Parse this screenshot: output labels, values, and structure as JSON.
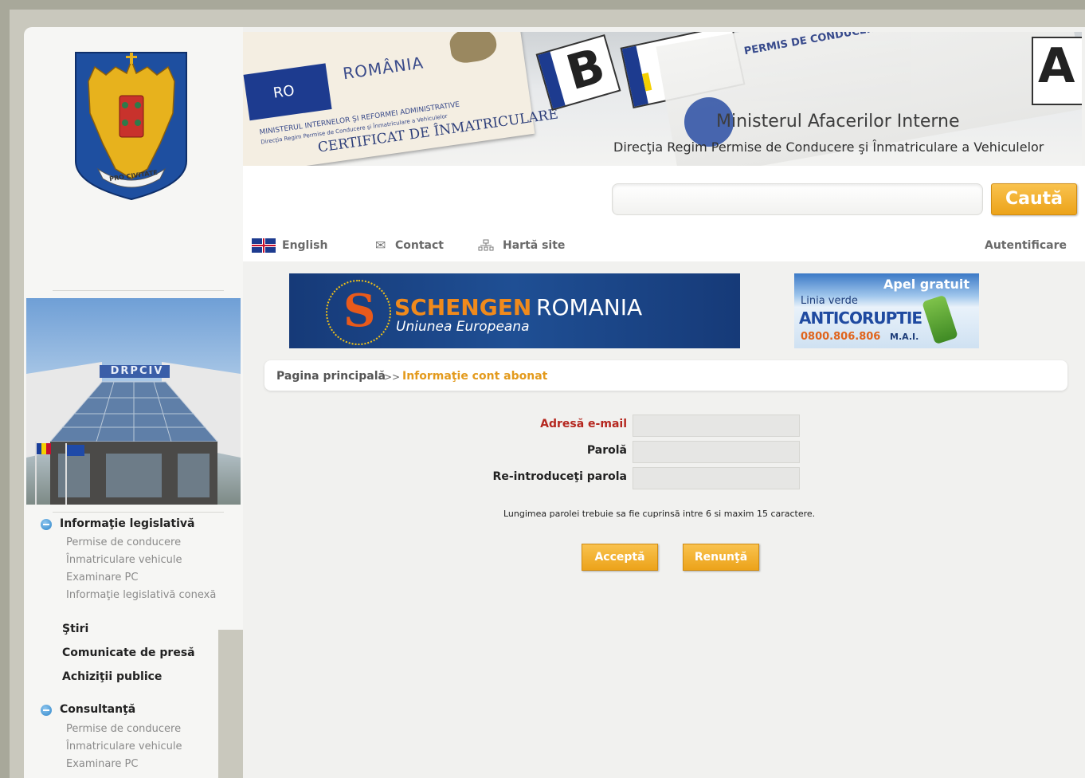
{
  "header": {
    "card_country": "ROMÂNIA",
    "card_ministry": "MINISTERUL INTERNELOR ŞI REFORMEI ADMINISTRATIVE",
    "card_directorate": "Direcţia Regim Permise de Conducere şi Înmatriculare a Vehiculelor",
    "card_footer": "CERTIFICAT DE ÎNMATRICULARE",
    "eu_code": "RO",
    "license_title": "PERMIS DE CONDUCERE",
    "ministry_title": "Ministerul Afacerilor Interne",
    "directorate_title": "Direcţia Regim Permise de Conducere şi Înmatriculare a Vehiculelor",
    "plate_letter_1": "B",
    "plate_letter_2": "A"
  },
  "logo": {
    "motto": "PRO CIVITATE"
  },
  "search": {
    "placeholder": "",
    "button_label": "Caută"
  },
  "toolbar": {
    "english_label": "English",
    "contact_label": "Contact",
    "sitemap_label": "Hartă site",
    "login_label": "Autentificare"
  },
  "banners": {
    "schengen_title_1": "SCHENGEN",
    "schengen_title_2": "ROMANIA",
    "schengen_subtitle": "Uniunea Europeana",
    "anticorruption_top": "Apel gratuit",
    "anticorruption_line": "Linia verde",
    "anticorruption_title": "ANTICORUPTIE",
    "anticorruption_phone": "0800.806.806",
    "anticorruption_org": "M.A.I."
  },
  "building_sign": "DRPCIV",
  "breadcrumb": {
    "home": "Pagina principală",
    "separator": ">>",
    "current": "Informaţie cont abonat"
  },
  "form": {
    "email_label": "Adresă e-mail",
    "password_label": "Parolă",
    "confirm_label": "Re-introduceţi parola",
    "email_value": "",
    "password_value": "",
    "confirm_value": "",
    "hint": "Lungimea parolei trebuie sa fie cuprinsă intre 6 si maxim 15 caractere.",
    "accept_label": "Acceptă",
    "cancel_label": "Renunţă"
  },
  "sidebar": {
    "section_legislation": "Informaţie legislativă",
    "legislation_items": [
      "Permise de conducere",
      "Înmatriculare vehicule",
      "Examinare PC",
      "Informaţie legislativă conexă"
    ],
    "news": "Ştiri",
    "press": "Comunicate de presă",
    "procurement": "Achiziţii publice",
    "section_consulting": "Consultanţă",
    "consulting_items": [
      "Permise de conducere",
      "Înmatriculare vehicule",
      "Examinare PC"
    ]
  },
  "colors": {
    "accent_orange": "#eca31a",
    "email_label_red": "#b5271f",
    "breadcrumb_current": "#e39a1c",
    "frame_bg": "#c9c8bd"
  }
}
